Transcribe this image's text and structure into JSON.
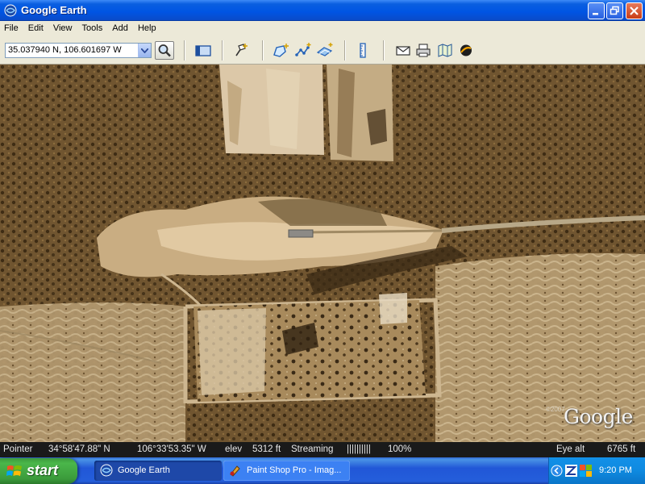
{
  "window": {
    "title": "Google Earth"
  },
  "menu": {
    "items": [
      "File",
      "Edit",
      "View",
      "Tools",
      "Add",
      "Help"
    ]
  },
  "toolbar": {
    "coordinates_value": "35.037940 N, 106.601697 W",
    "icons": [
      "search-icon",
      "sidebar-toggle-icon",
      "placemark-icon",
      "polygon-icon",
      "path-icon",
      "image-overlay-icon",
      "ruler-icon",
      "email-icon",
      "print-icon",
      "maps-icon",
      "sky-icon"
    ]
  },
  "map": {
    "copyright": "©2007",
    "logo_text": "Google"
  },
  "status": {
    "pointer_label": "Pointer",
    "lat": "34°58'47.88\" N",
    "lon": "106°33'53.35\" W",
    "elev_label": "elev",
    "elev_value": "5312 ft",
    "streaming_label": "Streaming",
    "streaming_bar": "||||||||||",
    "streaming_pct": "100%",
    "eye_alt_label": "Eye alt",
    "eye_alt_value": "6765 ft"
  },
  "taskbar": {
    "start_label": "start",
    "items": [
      {
        "label": "Google Earth",
        "active": true
      },
      {
        "label": "Paint Shop Pro - Imag...",
        "active": false
      }
    ],
    "clock": "9:20 PM"
  },
  "colors": {
    "title_blue": "#0054e3",
    "taskbar_blue": "#245edb",
    "start_green": "#3b9b3b",
    "chrome_gray": "#ece9d8"
  }
}
